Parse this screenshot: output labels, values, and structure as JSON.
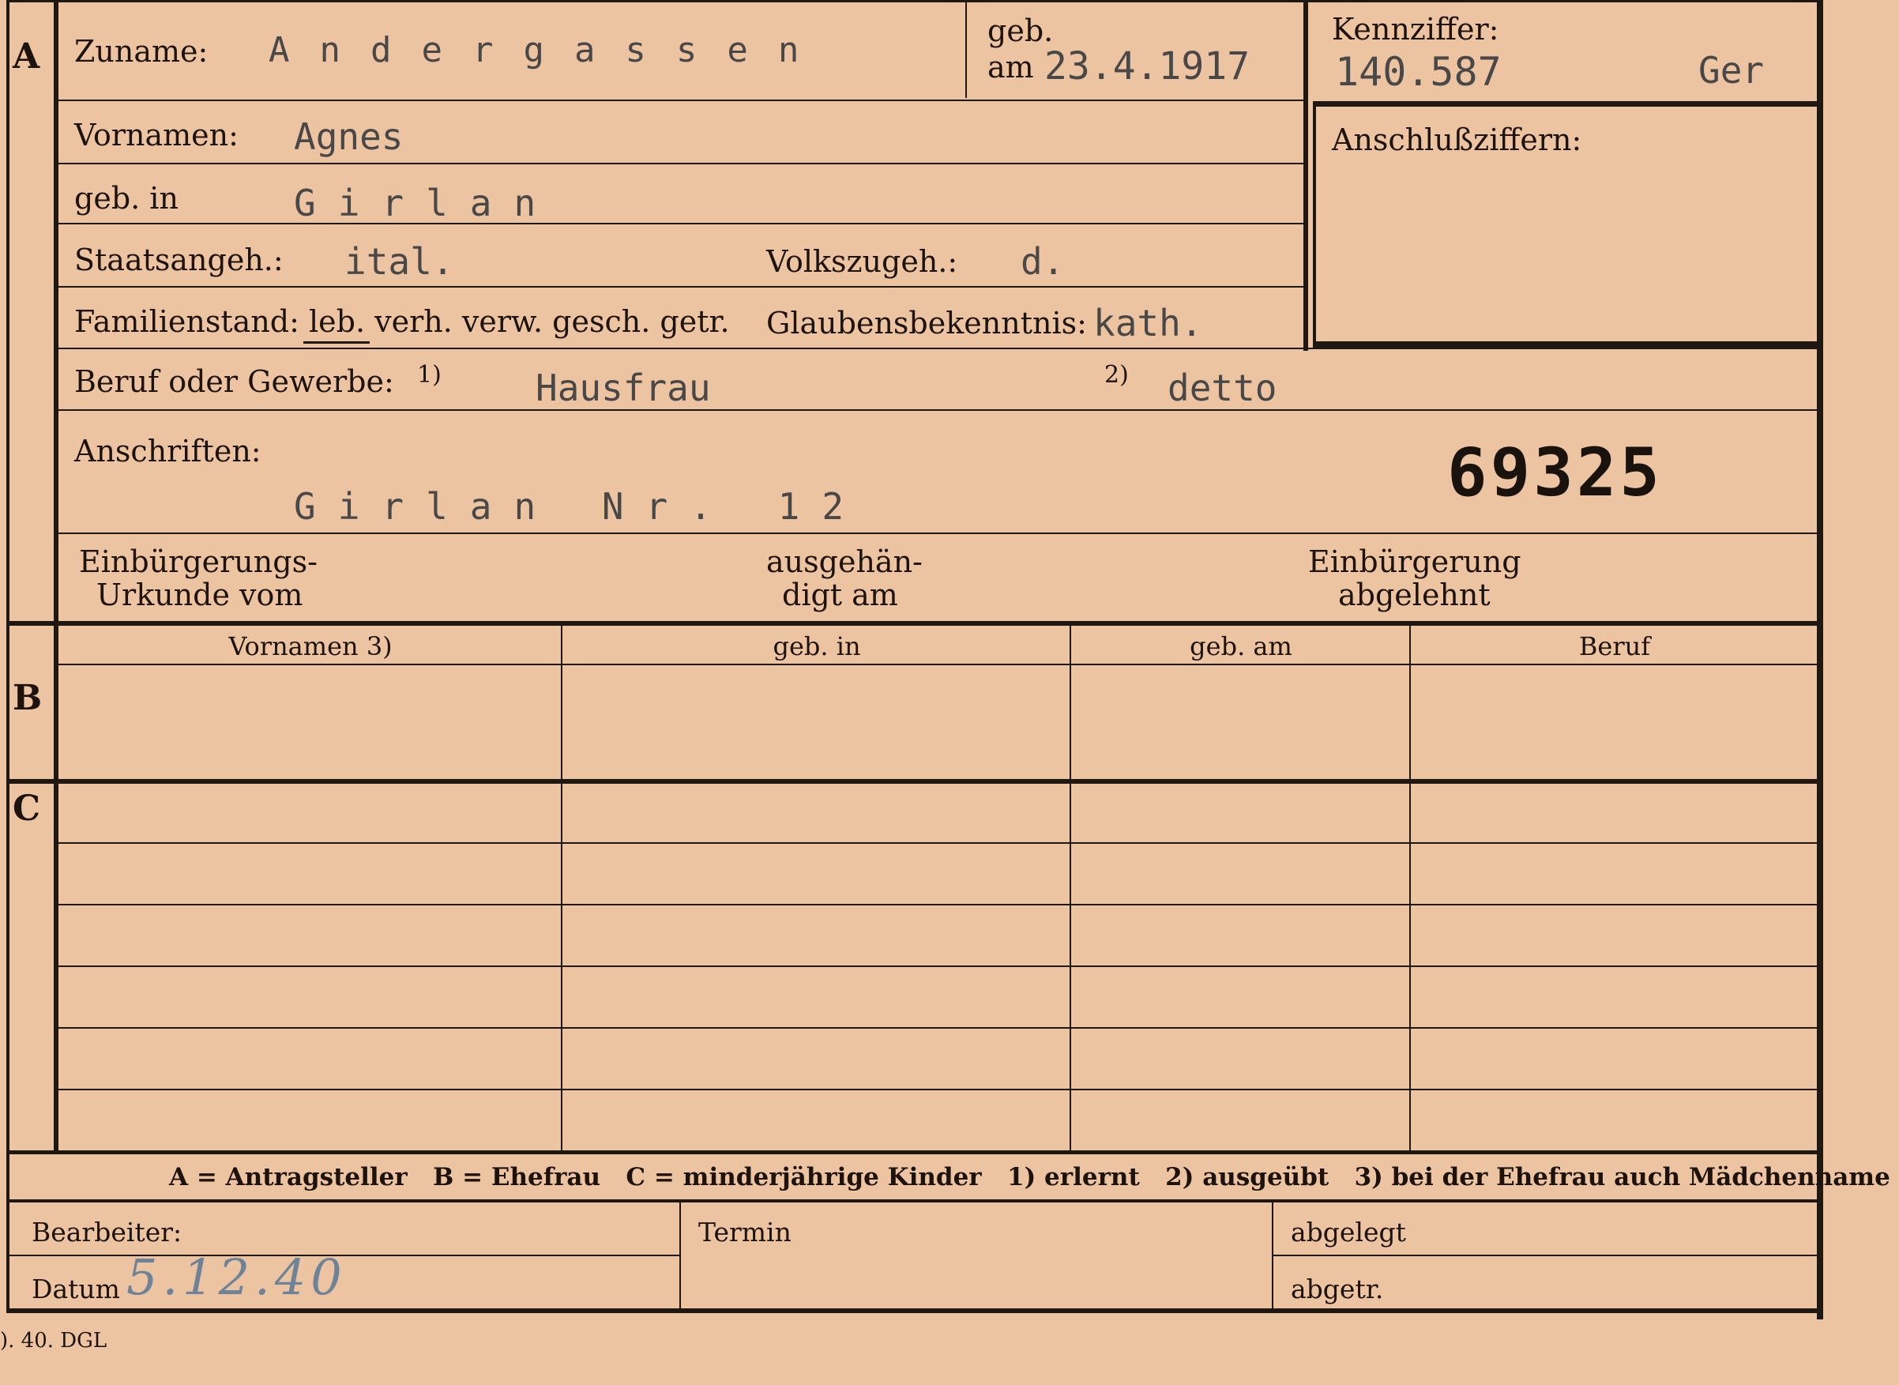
{
  "section_a": {
    "marker": "A",
    "surname_label": "Zuname:",
    "surname_value": "Andergassen",
    "dob_label_1": "geb.",
    "dob_label_2": "am",
    "dob_value": "23.4.1917",
    "id_label": "Kennziffer:",
    "id_value": "140.587",
    "id_suffix": "Ger",
    "connection_label": "Anschlußziffern:",
    "firstname_label": "Vornamen:",
    "firstname_value": "Agnes",
    "birthplace_label": "geb. in",
    "birthplace_value": "Girlan",
    "citizenship_label": "Staatsangeh.:",
    "citizenship_value": "ital.",
    "ethnicity_label": "Volkszugeh.:",
    "ethnicity_value": "d.",
    "marital_label": "Familienstand: leb. verh. verw. gesch. getr.",
    "religion_label": "Glaubensbekenntnis:",
    "religion_value": "kath.",
    "occupation_label": "Beruf oder Gewerbe:",
    "occ_note_1": "1)",
    "occupation_value_1": "Hausfrau",
    "occ_note_2": "2)",
    "occupation_value_2": "detto",
    "address_label": "Anschriften:",
    "address_value": "Girlan Nr. 12",
    "stamp_number": "69325",
    "naturalization_label_1": "Einbürgerungs-",
    "naturalization_label_2": "Urkunde vom",
    "handed_label_1": "ausgehän-",
    "handed_label_2": "digt am",
    "rejected_label_1": "Einbürgerung",
    "rejected_label_2": "abgelehnt"
  },
  "table": {
    "headers": [
      "Vornamen 3)",
      "geb. in",
      "geb. am",
      "Beruf"
    ],
    "marker_b": "B",
    "marker_c": "C"
  },
  "legend": "A = Antragsteller   B = Ehefrau   C = minderjährige Kinder   1) erlernt   2) ausgeübt   3) bei der Ehefrau auch Mädchenname",
  "footer": {
    "processor_label": "Bearbeiter:",
    "date_label": "Datum",
    "date_value": "5.12.40",
    "deadline_label": "Termin",
    "filed_label": "abgelegt",
    "removed_label": "abgetr.",
    "print_code": "). 40. DGL"
  },
  "colors": {
    "paper": "#ecc4a2",
    "ink": "#1e130c",
    "typewriter": "#4a4846",
    "handwriting": "#6f8398"
  }
}
